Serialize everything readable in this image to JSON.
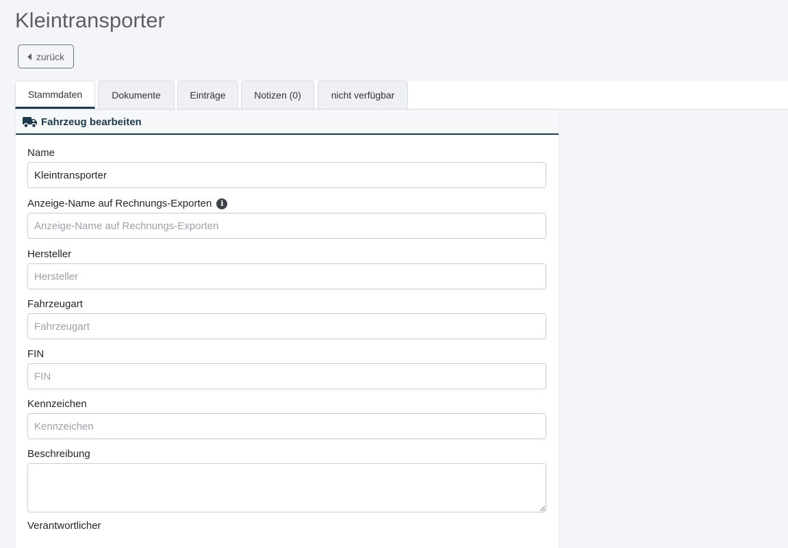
{
  "page": {
    "title": "Kleintransporter",
    "back_label": "zurück"
  },
  "tabs": [
    {
      "label": "Stammdaten",
      "active": true
    },
    {
      "label": "Dokumente",
      "active": false
    },
    {
      "label": "Einträge",
      "active": false
    },
    {
      "label": "Notizen (0)",
      "active": false
    },
    {
      "label": "nicht verfügbar",
      "active": false
    }
  ],
  "card": {
    "title": "Fahrzeug bearbeiten",
    "icon": "truck-icon"
  },
  "form": {
    "name": {
      "label": "Name",
      "value": "Kleintransporter",
      "placeholder": ""
    },
    "display_name": {
      "label": "Anzeige-Name auf Rechnungs-Exporten",
      "value": "",
      "placeholder": "Anzeige-Name auf Rechnungs-Exporten"
    },
    "manufacturer": {
      "label": "Hersteller",
      "value": "",
      "placeholder": "Hersteller"
    },
    "vehicle_type": {
      "label": "Fahrzeugart",
      "value": "",
      "placeholder": "Fahrzeugart"
    },
    "fin": {
      "label": "FIN",
      "value": "",
      "placeholder": "FIN"
    },
    "plate": {
      "label": "Kennzeichen",
      "value": "",
      "placeholder": "Kennzeichen"
    },
    "description": {
      "label": "Beschreibung",
      "value": ""
    },
    "responsible": {
      "label": "Verantwortlicher"
    }
  },
  "colors": {
    "accent": "#1d3a4d",
    "page_bg": "#f4f5f9"
  }
}
